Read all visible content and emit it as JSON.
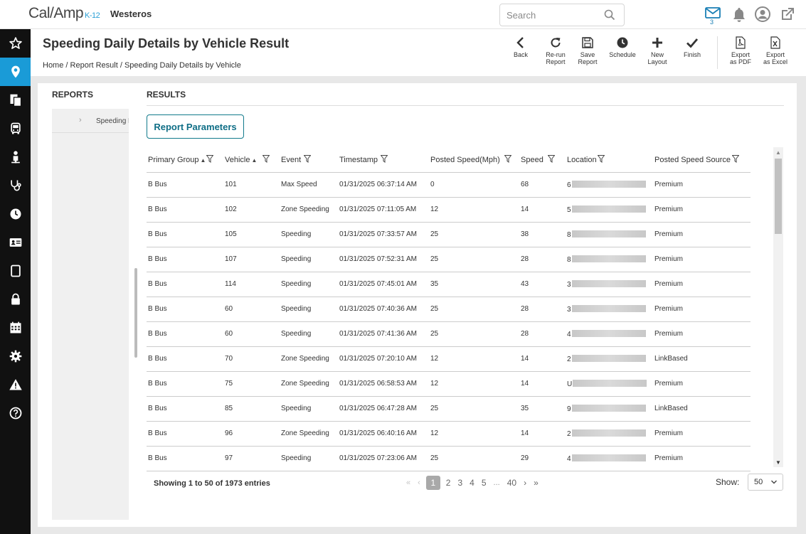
{
  "app": {
    "logo": "Cal/Amp",
    "logo_suffix": "K-12",
    "tenant": "Westeros"
  },
  "search": {
    "placeholder": "Search"
  },
  "notifications": {
    "mail_count": "3"
  },
  "page": {
    "title": "Speeding Daily Details by Vehicle Result",
    "breadcrumb": [
      "Home",
      "Report Result",
      "Speeding Daily Details by Vehicle"
    ]
  },
  "toolbar": {
    "back": "Back",
    "rerun": [
      "Re-run",
      "Report"
    ],
    "save": [
      "Save",
      "Report"
    ],
    "schedule": "Schedule",
    "new_layout": [
      "New",
      "Layout"
    ],
    "finish": "Finish",
    "export_pdf": [
      "Export",
      "as PDF"
    ],
    "export_excel": [
      "Export",
      "as Excel"
    ]
  },
  "reports_panel": {
    "label": "REPORTS",
    "item": "Speeding Daily Details by Vehicle"
  },
  "results": {
    "label": "RESULTS",
    "params_button": "Report Parameters",
    "columns": [
      "Primary Group",
      "Vehicle",
      "Event",
      "Timestamp",
      "Posted Speed(Mph)",
      "Speed",
      "Location",
      "Posted Speed Source"
    ],
    "rows": [
      {
        "group": "B Bus",
        "vehicle": "101",
        "event": "Max Speed",
        "timestamp": "01/31/2025 06:37:14 AM",
        "posted": "0",
        "speed": "68",
        "loc": "6",
        "source": "Premium"
      },
      {
        "group": "B Bus",
        "vehicle": "102",
        "event": "Zone Speeding",
        "timestamp": "01/31/2025 07:11:05 AM",
        "posted": "12",
        "speed": "14",
        "loc": "5",
        "source": "Premium"
      },
      {
        "group": "B Bus",
        "vehicle": "105",
        "event": "Speeding",
        "timestamp": "01/31/2025 07:33:57 AM",
        "posted": "25",
        "speed": "38",
        "loc": "8",
        "source": "Premium"
      },
      {
        "group": "B Bus",
        "vehicle": "107",
        "event": "Speeding",
        "timestamp": "01/31/2025 07:52:31 AM",
        "posted": "25",
        "speed": "28",
        "loc": "8",
        "source": "Premium"
      },
      {
        "group": "B Bus",
        "vehicle": "114",
        "event": "Speeding",
        "timestamp": "01/31/2025 07:45:01 AM",
        "posted": "35",
        "speed": "43",
        "loc": "3",
        "source": "Premium"
      },
      {
        "group": "B Bus",
        "vehicle": "60",
        "event": "Speeding",
        "timestamp": "01/31/2025 07:40:36 AM",
        "posted": "25",
        "speed": "28",
        "loc": "3",
        "source": "Premium"
      },
      {
        "group": "B Bus",
        "vehicle": "60",
        "event": "Speeding",
        "timestamp": "01/31/2025 07:41:36 AM",
        "posted": "25",
        "speed": "28",
        "loc": "4",
        "source": "Premium"
      },
      {
        "group": "B Bus",
        "vehicle": "70",
        "event": "Zone Speeding",
        "timestamp": "01/31/2025 07:20:10 AM",
        "posted": "12",
        "speed": "14",
        "loc": "2",
        "source": "LinkBased"
      },
      {
        "group": "B Bus",
        "vehicle": "75",
        "event": "Zone Speeding",
        "timestamp": "01/31/2025 06:58:53 AM",
        "posted": "12",
        "speed": "14",
        "loc": "U",
        "source": "Premium"
      },
      {
        "group": "B Bus",
        "vehicle": "85",
        "event": "Speeding",
        "timestamp": "01/31/2025 06:47:28 AM",
        "posted": "25",
        "speed": "35",
        "loc": "9",
        "source": "LinkBased"
      },
      {
        "group": "B Bus",
        "vehicle": "96",
        "event": "Zone Speeding",
        "timestamp": "01/31/2025 06:40:16 AM",
        "posted": "12",
        "speed": "14",
        "loc": "2",
        "source": "Premium"
      },
      {
        "group": "B Bus",
        "vehicle": "97",
        "event": "Speeding",
        "timestamp": "01/31/2025 07:23:06 AM",
        "posted": "25",
        "speed": "29",
        "loc": "4",
        "source": "Premium"
      }
    ],
    "showing": "Showing 1 to 50 of 1973 entries",
    "pages": [
      "1",
      "2",
      "3",
      "4",
      "5",
      "...",
      "40"
    ],
    "show_label": "Show:",
    "page_size": "50"
  },
  "sidebar_icons": [
    "star-icon",
    "map-pin-icon",
    "reports-icon",
    "bus-icon",
    "student-icon",
    "stethoscope-icon",
    "clock-icon",
    "id-card-icon",
    "tablet-icon",
    "lock-icon",
    "calendar-icon",
    "gear-icon",
    "warning-icon",
    "help-icon"
  ],
  "colors": {
    "accent": "#1a9bd7",
    "button_border": "#117a8b",
    "sidebar": "#111111"
  }
}
